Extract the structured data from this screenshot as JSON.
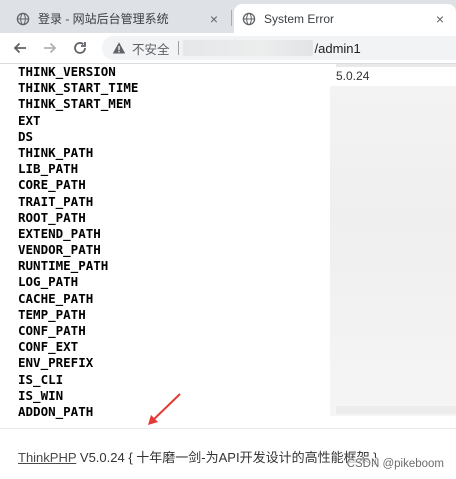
{
  "tabs": [
    {
      "label": "登录 - 网站后台管理系统",
      "active": false
    },
    {
      "label": "System Error",
      "active": true
    }
  ],
  "tab_close_glyph": "×",
  "toolbar": {
    "insecure_label": "不安全",
    "url_path": "/admin1"
  },
  "constants": [
    "THINK_VERSION",
    "THINK_START_TIME",
    "THINK_START_MEM",
    "EXT",
    "DS",
    "THINK_PATH",
    "LIB_PATH",
    "CORE_PATH",
    "TRAIT_PATH",
    "ROOT_PATH",
    "EXTEND_PATH",
    "VENDOR_PATH",
    "RUNTIME_PATH",
    "LOG_PATH",
    "CACHE_PATH",
    "TEMP_PATH",
    "CONF_PATH",
    "CONF_EXT",
    "ENV_PREFIX",
    "IS_CLI",
    "IS_WIN",
    "ADDON_PATH"
  ],
  "values": {
    "think_version": "5.0.24"
  },
  "footer": {
    "brand": "ThinkPHP",
    "version": " V5.0.24 ",
    "slogan": "{ 十年磨一剑-为API开发设计的高性能框架 }"
  },
  "watermark": "CSDN @pikeboom",
  "colors": {
    "tabstrip": "#dee1e6",
    "omnibox": "#f1f3f4",
    "annotation_arrow": "#e53935"
  }
}
